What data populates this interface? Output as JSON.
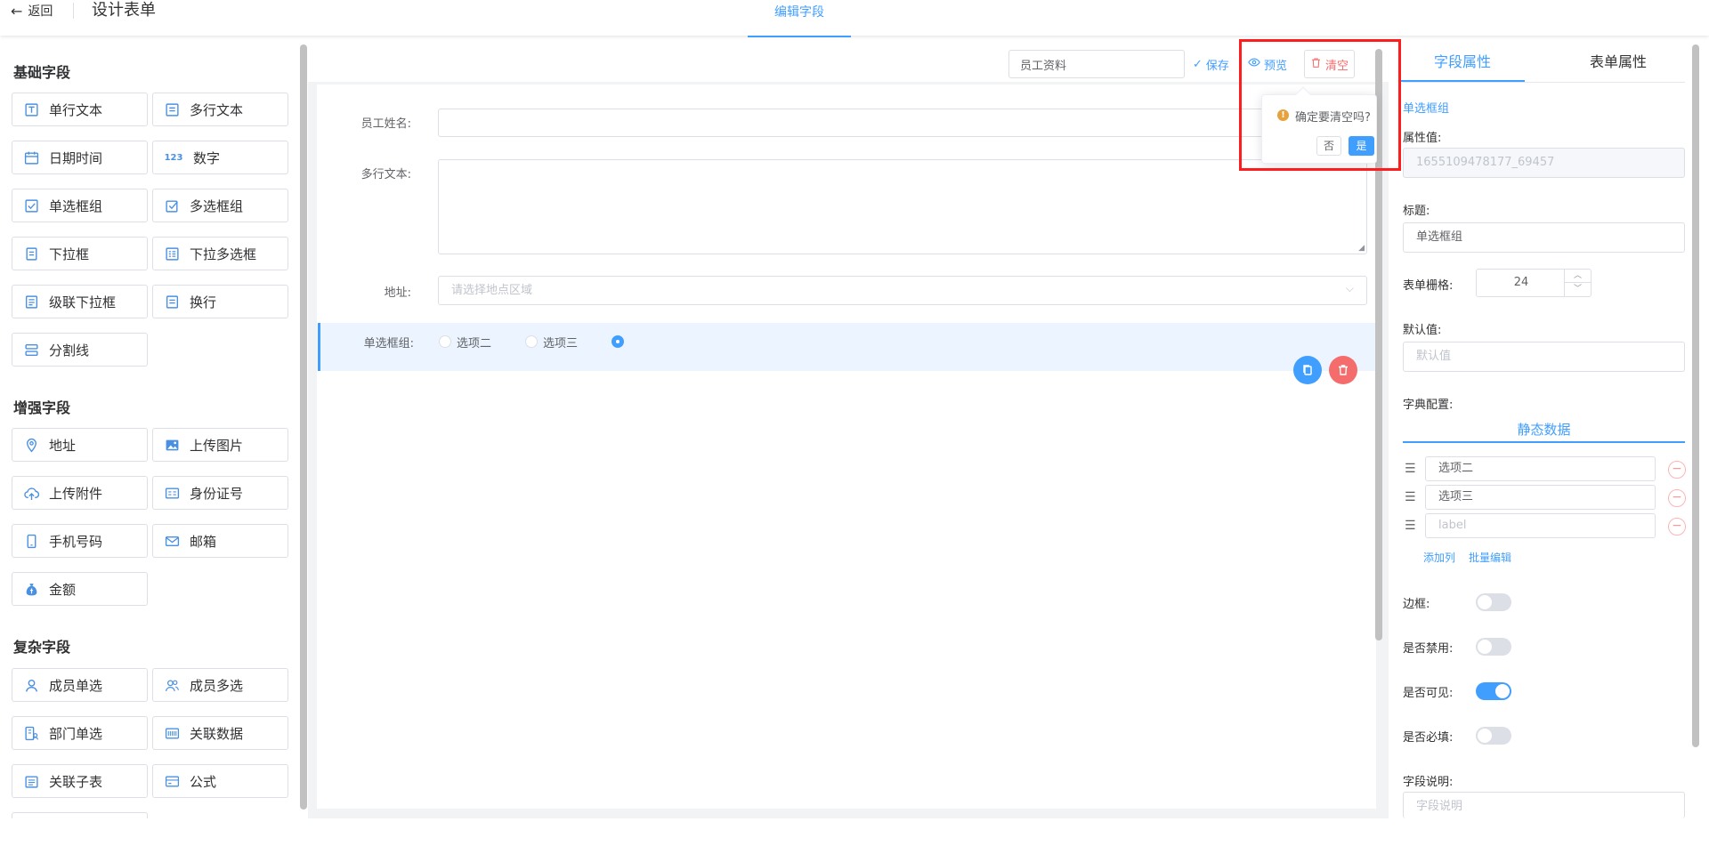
{
  "header": {
    "back_label": "返回",
    "title": "设计表单",
    "tab_label": "编辑字段"
  },
  "left": {
    "groups": [
      {
        "title": "基础字段",
        "items": [
          {
            "label": "单行文本",
            "icon": "text-input-icon"
          },
          {
            "label": "多行文本",
            "icon": "textarea-icon"
          },
          {
            "label": "日期时间",
            "icon": "calendar-icon"
          },
          {
            "label": "数字",
            "icon": "number-icon"
          },
          {
            "label": "单选框组",
            "icon": "radio-icon"
          },
          {
            "label": "多选框组",
            "icon": "checkbox-icon"
          },
          {
            "label": "下拉框",
            "icon": "select-icon"
          },
          {
            "label": "下拉多选框",
            "icon": "multi-select-icon"
          },
          {
            "label": "级联下拉框",
            "icon": "cascader-icon"
          },
          {
            "label": "换行",
            "icon": "line-break-icon"
          },
          {
            "label": "分割线",
            "icon": "divider-icon"
          }
        ]
      },
      {
        "title": "增强字段",
        "items": [
          {
            "label": "地址",
            "icon": "location-icon"
          },
          {
            "label": "上传图片",
            "icon": "image-icon"
          },
          {
            "label": "上传附件",
            "icon": "cloud-upload-icon"
          },
          {
            "label": "身份证号",
            "icon": "id-card-icon"
          },
          {
            "label": "手机号码",
            "icon": "phone-icon"
          },
          {
            "label": "邮箱",
            "icon": "mail-icon"
          },
          {
            "label": "金额",
            "icon": "money-bag-icon"
          }
        ]
      },
      {
        "title": "复杂字段",
        "items": [
          {
            "label": "成员单选",
            "icon": "user-icon"
          },
          {
            "label": "成员多选",
            "icon": "users-icon"
          },
          {
            "label": "部门单选",
            "icon": "department-icon"
          },
          {
            "label": "关联数据",
            "icon": "barcode-icon"
          },
          {
            "label": "关联子表",
            "icon": "sub-table-icon"
          },
          {
            "label": "公式",
            "icon": "formula-icon"
          }
        ]
      }
    ]
  },
  "toolbar": {
    "form_name": "员工资料",
    "save_label": "保存",
    "preview_label": "预览",
    "clear_label": "清空"
  },
  "popconfirm": {
    "message": "确定要清空吗?",
    "no_label": "否",
    "yes_label": "是"
  },
  "form": {
    "name_label": "员工姓名:",
    "textarea_label": "多行文本:",
    "address_label": "地址:",
    "address_placeholder": "请选择地点区域",
    "radio_label": "单选框组:",
    "radio_options": [
      "选项二",
      "选项三",
      ""
    ]
  },
  "right": {
    "tabs": [
      "字段属性",
      "表单属性"
    ],
    "field_type": "单选框组",
    "prop_value_label": "属性值:",
    "prop_value": "1655109478177_69457",
    "title_label": "标题:",
    "title_value": "单选框组",
    "grid_label": "表单栅格:",
    "grid_value": "24",
    "default_label": "默认值:",
    "default_placeholder": "默认值",
    "dict_label": "字典配置:",
    "dict_tab": "静态数据",
    "options": [
      "选项二",
      "选项三"
    ],
    "option_placeholder": "label",
    "add_col_label": "添加列",
    "batch_edit_label": "批量编辑",
    "border_label": "边框:",
    "disabled_label": "是否禁用:",
    "visible_label": "是否可见:",
    "required_label": "是否必填:",
    "desc_label": "字段说明:",
    "desc_placeholder": "字段说明",
    "switches": {
      "border": false,
      "disabled": false,
      "visible": true,
      "required": false
    }
  },
  "colors": {
    "primary": "#409eff",
    "danger": "#f56c6c",
    "highlight": "#ff1c1c"
  }
}
